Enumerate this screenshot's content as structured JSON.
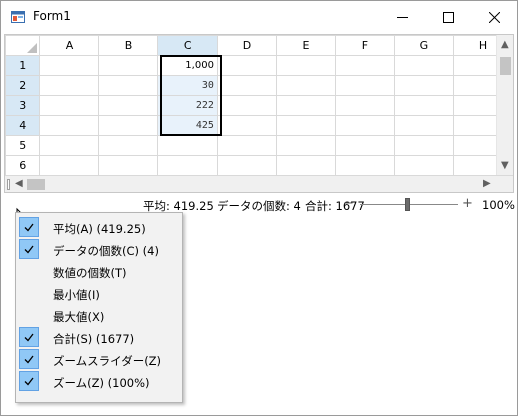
{
  "window": {
    "title": "Form1",
    "minimize_glyph": "—",
    "maximize_glyph": "☐",
    "close_glyph": "✕"
  },
  "grid": {
    "columns": [
      "A",
      "B",
      "C",
      "D",
      "E",
      "F",
      "G",
      "H"
    ],
    "rows": [
      {
        "header": "1",
        "cells": [
          "",
          "",
          "1,000",
          "",
          "",
          "",
          "",
          ""
        ]
      },
      {
        "header": "2",
        "cells": [
          "",
          "",
          "30",
          "",
          "",
          "",
          "",
          ""
        ]
      },
      {
        "header": "3",
        "cells": [
          "",
          "",
          "222",
          "",
          "",
          "",
          "",
          ""
        ]
      },
      {
        "header": "4",
        "cells": [
          "",
          "",
          "425",
          "",
          "",
          "",
          "",
          ""
        ]
      },
      {
        "header": "5",
        "cells": [
          "",
          "",
          "",
          "",
          "",
          "",
          "",
          ""
        ]
      },
      {
        "header": "6",
        "cells": [
          "",
          "",
          "",
          "",
          "",
          "",
          "",
          ""
        ]
      }
    ],
    "selected_column": "C",
    "selected_rows": [
      "1",
      "2",
      "3",
      "4"
    ]
  },
  "statusbar": {
    "average": "平均: 419.25",
    "count": "データの個数: 4",
    "sum": "合計: 1677",
    "zoom_minus": "−",
    "zoom_plus": "+",
    "zoom_level": "100%",
    "zoom_value_percent": 100
  },
  "context_menu": {
    "items": [
      {
        "label": "平均(A) (419.25)",
        "checked": true
      },
      {
        "label": "データの個数(C) (4)",
        "checked": true
      },
      {
        "label": "数値の個数(T)",
        "checked": false
      },
      {
        "label": "最小値(I)",
        "checked": false
      },
      {
        "label": "最大値(X)",
        "checked": false
      },
      {
        "label": "合計(S) (1677)",
        "checked": true
      },
      {
        "label": "ズームスライダー(Z)",
        "checked": true
      },
      {
        "label": "ズーム(Z) (100%)",
        "checked": true
      }
    ]
  },
  "colors": {
    "selection_header": "#d7e8f5",
    "selection_cell": "#e8f2fb",
    "menu_check_bg": "#90c8f6"
  }
}
